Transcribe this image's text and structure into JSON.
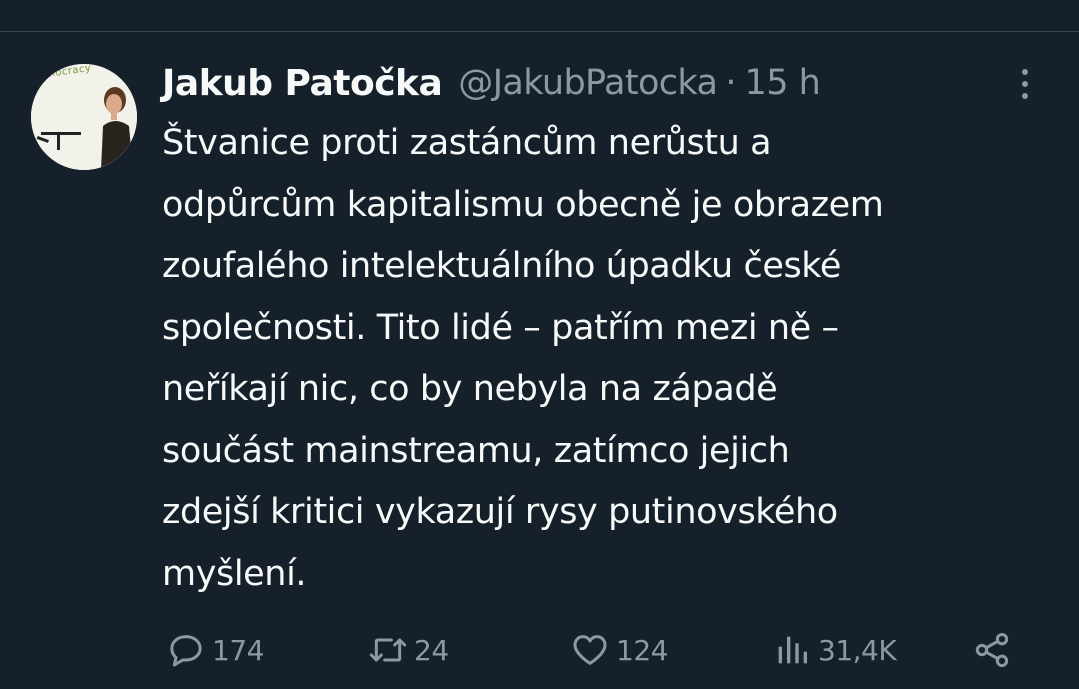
{
  "tweet": {
    "author_name": "Jakub Patočka",
    "handle": "@JakubPatocka",
    "separator": "·",
    "time": "15 h",
    "avatar_caption": "mocracy",
    "text_lines": [
      "Štvanice proti zastáncům nerůstu a",
      "odpůrcům kapitalismu obecně je obrazem",
      "zoufalého intelektuálního úpadku české",
      "společnosti. Tito lidé – patřím mezi ně –",
      "neříkají nic, co by nebyla na západě",
      "součást mainstreamu, zatímco jejich",
      "zdejší kritici vykazují rysy putinovského",
      "myšlení."
    ]
  },
  "actions": {
    "reply": {
      "icon": "reply-icon",
      "count": "174"
    },
    "retweet": {
      "icon": "retweet-icon",
      "count": "24"
    },
    "like": {
      "icon": "heart-icon",
      "count": "124"
    },
    "views": {
      "icon": "views-icon",
      "count": "31,4K"
    },
    "share": {
      "icon": "share-icon"
    }
  },
  "colors": {
    "background": "#15202b",
    "text_primary": "#f7f9f9",
    "text_secondary": "#8b98a5",
    "divider": "#38444d"
  }
}
